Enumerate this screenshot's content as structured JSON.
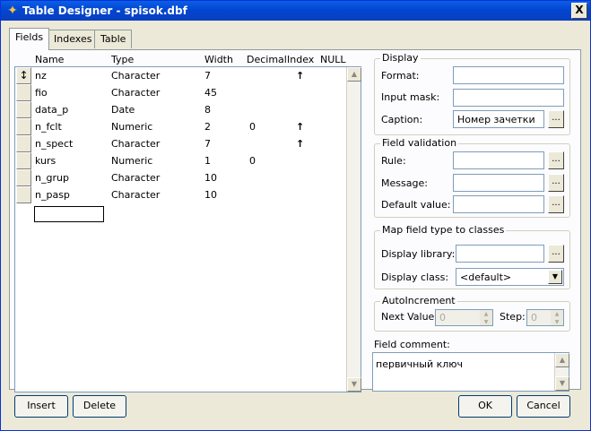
{
  "window": {
    "title": "Table Designer - spisok.dbf",
    "close_label": "X"
  },
  "tabs": [
    {
      "label": "Fields",
      "active": true
    },
    {
      "label": "Indexes",
      "active": false
    },
    {
      "label": "Table",
      "active": false
    }
  ],
  "grid": {
    "columns": [
      "Name",
      "Type",
      "Width",
      "Decimal",
      "Index",
      "NULL"
    ],
    "rows": [
      {
        "name": "nz",
        "type": "Character",
        "width": "7",
        "decimal": "",
        "index": "↑",
        "selector": "↕"
      },
      {
        "name": "fio",
        "type": "Character",
        "width": "45",
        "decimal": "",
        "index": "",
        "selector": ""
      },
      {
        "name": "data_p",
        "type": "Date",
        "width": "8",
        "decimal": "",
        "index": "",
        "selector": ""
      },
      {
        "name": "n_fclt",
        "type": "Numeric",
        "width": "2",
        "decimal": "0",
        "index": "↑",
        "selector": ""
      },
      {
        "name": "n_spect",
        "type": "Character",
        "width": "7",
        "decimal": "",
        "index": "↑",
        "selector": ""
      },
      {
        "name": "kurs",
        "type": "Numeric",
        "width": "1",
        "decimal": "0",
        "index": "",
        "selector": ""
      },
      {
        "name": "n_grup",
        "type": "Character",
        "width": "10",
        "decimal": "",
        "index": "",
        "selector": ""
      },
      {
        "name": "n_pasp",
        "type": "Character",
        "width": "10",
        "decimal": "",
        "index": "",
        "selector": ""
      }
    ]
  },
  "display": {
    "title": "Display",
    "format_label": "Format:",
    "format_value": "",
    "input_mask_label": "Input mask:",
    "input_mask_value": "",
    "caption_label": "Caption:",
    "caption_value": "Номер зачетки"
  },
  "validation": {
    "title": "Field validation",
    "rule_label": "Rule:",
    "rule_value": "",
    "message_label": "Message:",
    "message_value": "",
    "default_label": "Default value:",
    "default_value": ""
  },
  "mapping": {
    "title": "Map field type to classes",
    "library_label": "Display library:",
    "library_value": "",
    "class_label": "Display class:",
    "class_value": "<default>"
  },
  "autoincrement": {
    "title": "AutoIncrement",
    "next_label": "Next Value:",
    "next_value": "0",
    "step_label": "Step:",
    "step_value": "0"
  },
  "comment": {
    "label": "Field comment:",
    "value": "первичный ключ"
  },
  "buttons": {
    "ellipsis": "...",
    "insert": "Insert",
    "delete": "Delete",
    "ok": "OK",
    "cancel": "Cancel"
  }
}
